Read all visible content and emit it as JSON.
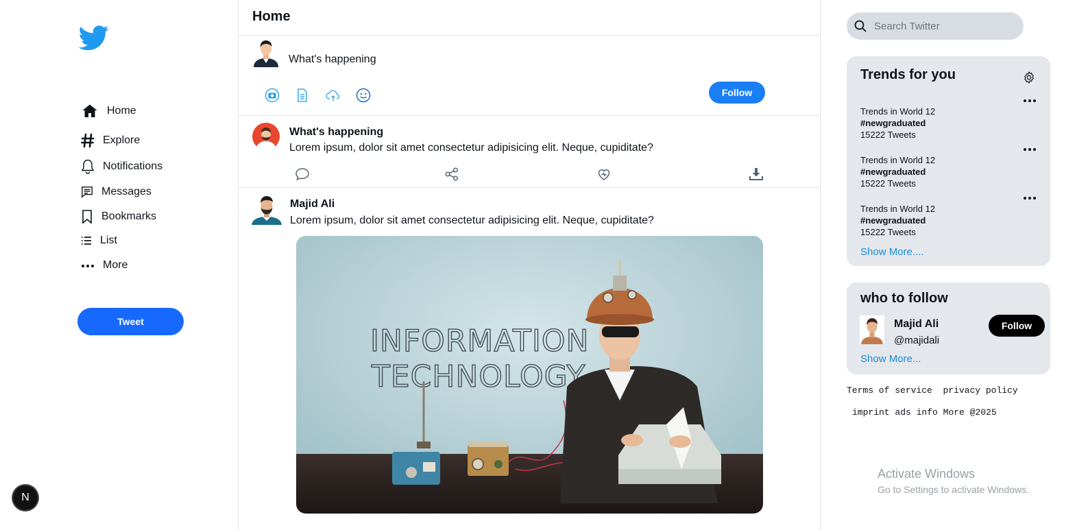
{
  "sidebar": {
    "items": [
      {
        "label": "Home",
        "icon": "home-icon"
      },
      {
        "label": "Explore",
        "icon": "hash-icon"
      },
      {
        "label": "Notifications",
        "icon": "bell-icon"
      },
      {
        "label": "Messages",
        "icon": "message-icon"
      },
      {
        "label": "Bookmarks",
        "icon": "bookmark-icon"
      },
      {
        "label": "List",
        "icon": "list-icon"
      },
      {
        "label": "More",
        "icon": "more-dots-icon"
      }
    ],
    "tweet_label": "Tweet",
    "badge_label": "N"
  },
  "main": {
    "title": "Home",
    "composer": {
      "placeholder": "What's happening",
      "follow_label": "Follow",
      "tools": [
        "camera-icon",
        "document-icon",
        "cloud-upload-icon",
        "smile-icon"
      ]
    },
    "posts": [
      {
        "name": "What's happening",
        "text": "Lorem ipsum, dolor sit amet consectetur adipisicing elit. Neque, cupiditate?",
        "actions": [
          "comment-icon",
          "share-icon",
          "heart-icon",
          "download-icon"
        ]
      },
      {
        "name": "Majid Ali",
        "text": "Lorem ipsum, dolor sit amet consectetur adipisicing elit. Neque, cupiditate?",
        "image_text_line1": "INFORMATION",
        "image_text_line2": "TECHNOLOGY"
      }
    ]
  },
  "right": {
    "search_placeholder": "Search Twitter",
    "trends": {
      "title": "Trends for you",
      "items": [
        {
          "context": "Trends in World 12",
          "tag": "#newgraduated",
          "count": "15222 Tweets"
        },
        {
          "context": "Trends in World 12",
          "tag": "#newgraduated",
          "count": "15222 Tweets"
        },
        {
          "context": "Trends in World 12",
          "tag": "#newgraduated",
          "count": "15222 Tweets"
        }
      ],
      "show_more": "Show More...."
    },
    "who_to_follow": {
      "title": "who to follow",
      "name": "Majid Ali",
      "handle": "@majidali",
      "follow_label": "Follow",
      "show_more": "Show More..."
    },
    "footer": {
      "line1": [
        "Terms of service",
        "privacy policy"
      ],
      "line2": [
        "imprint",
        "ads info",
        "More",
        "@2025"
      ]
    }
  },
  "overlay": {
    "activate_title": "Activate Windows",
    "activate_sub": "Go to Settings to activate Windows."
  },
  "colors": {
    "brand_blue": "#1d9bf0",
    "tweet_button": "#1768ff",
    "link": "#1a8cd8",
    "card_bg": "#e4e7eb"
  }
}
